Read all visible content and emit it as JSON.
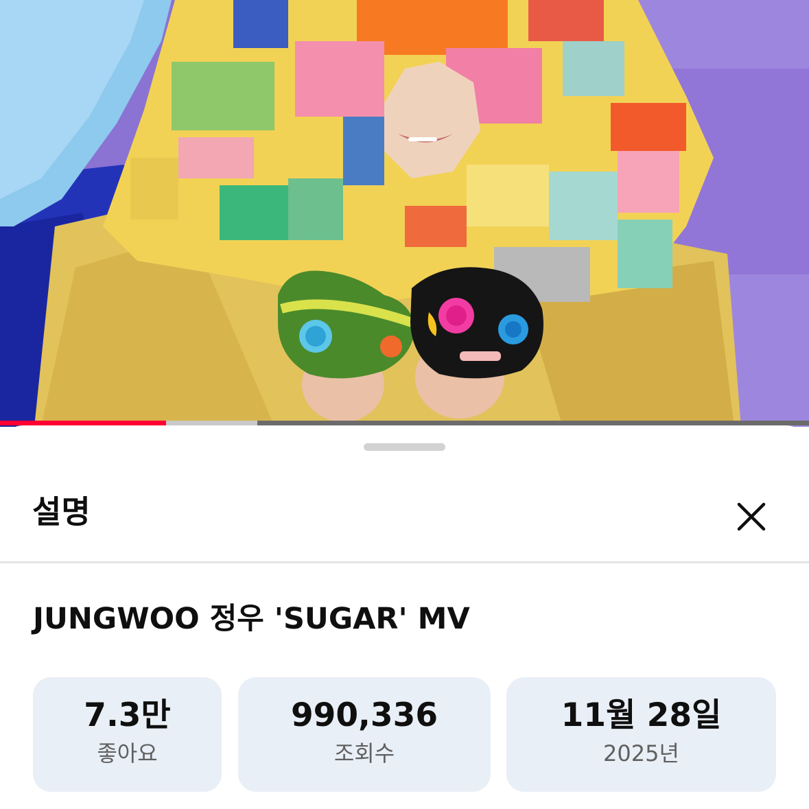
{
  "player": {
    "progress_played": 0.205,
    "progress_buffered": 0.318,
    "colors": {
      "played": "#ff0033",
      "buffered": "#c9c9c9",
      "track": "#6b6b6b"
    }
  },
  "sheet": {
    "title": "설명",
    "close_icon": "close-icon"
  },
  "video": {
    "title": "JUNGWOO 정우 'SUGAR' MV"
  },
  "stats": [
    {
      "value": "7.3만",
      "label": "좋아요"
    },
    {
      "value": "990,336",
      "label": "조회수"
    },
    {
      "value": "11월 28일",
      "label": "2025년"
    }
  ]
}
